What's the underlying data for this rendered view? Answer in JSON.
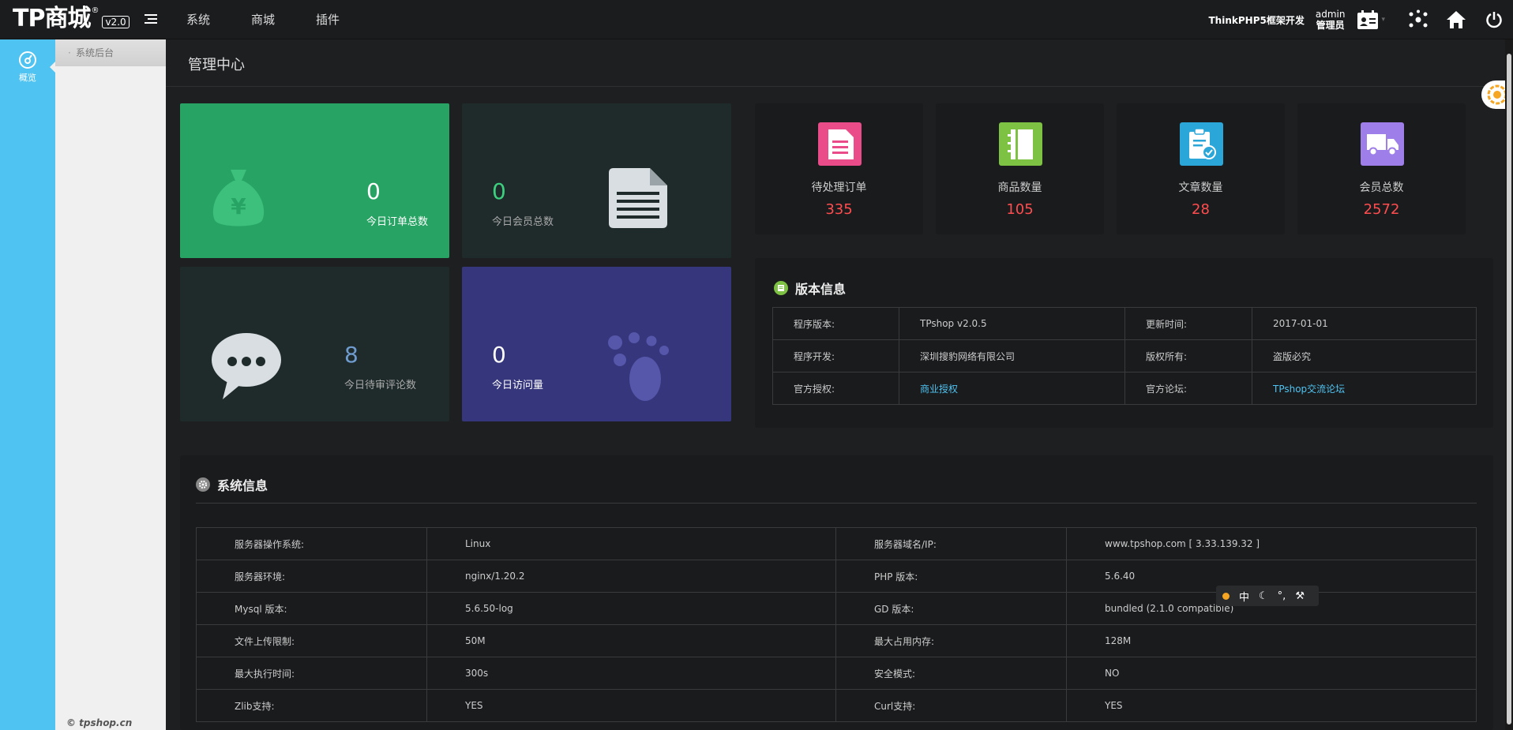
{
  "brand": {
    "logo_text": "TP商城",
    "reg_mark": "®",
    "version": "v2.0"
  },
  "topnav": [
    "系统",
    "商城",
    "插件"
  ],
  "topright": {
    "framework_text": "ThinkPHP5框架开发",
    "user_name": "admin",
    "user_role": "管理员"
  },
  "leftbar": {
    "overview_label": "概览"
  },
  "subbar": {
    "item": "系统后台",
    "copyright": "© tpshop.cn"
  },
  "page": {
    "title": "管理中心"
  },
  "tiles": [
    {
      "value": "0",
      "label": "今日订单总数",
      "color": "#27a464"
    },
    {
      "value": "0",
      "label": "今日会员总数",
      "color": "#1f2a2b"
    },
    {
      "value": "8",
      "label": "今日待审评论数",
      "color": "#1f2a2b"
    },
    {
      "value": "0",
      "label": "今日访问量",
      "color": "#35367c"
    }
  ],
  "stat_cards": [
    {
      "label": "待处理订单",
      "value": "335",
      "icon": "document-icon",
      "color": "#ea4c89"
    },
    {
      "label": "商品数量",
      "value": "105",
      "icon": "notebook-icon",
      "color": "#7dc242"
    },
    {
      "label": "文章数量",
      "value": "28",
      "icon": "clipboard-check-icon",
      "color": "#2aa6d8"
    },
    {
      "label": "会员总数",
      "value": "2572",
      "icon": "truck-icon",
      "color": "#9e7ee8"
    }
  ],
  "version_info": {
    "title": "版本信息",
    "rows": [
      [
        "程序版本:",
        "TPshop v2.0.5",
        "更新时间:",
        "2017-01-01"
      ],
      [
        "程序开发:",
        "深圳搜豹网络有限公司",
        "版权所有:",
        "盗版必究"
      ],
      [
        "官方授权:",
        "商业授权",
        "官方论坛:",
        "TPshop交流论坛"
      ]
    ]
  },
  "system_info": {
    "title": "系统信息",
    "rows": [
      [
        "服务器操作系统:",
        "Linux",
        "服务器域名/IP:",
        "www.tpshop.com [ 3.33.139.32 ]"
      ],
      [
        "服务器环境:",
        "nginx/1.20.2",
        "PHP 版本:",
        "5.6.40"
      ],
      [
        "Mysql 版本:",
        "5.6.50-log",
        "GD 版本:",
        "bundled (2.1.0 compatible)"
      ],
      [
        "文件上传限制:",
        "50M",
        "最大占用内存:",
        "128M"
      ],
      [
        "最大执行时间:",
        "300s",
        "安全模式:",
        "NO"
      ],
      [
        "Zlib支持:",
        "YES",
        "Curl支持:",
        "YES"
      ]
    ]
  },
  "ime_bar": {
    "lang": "中"
  }
}
